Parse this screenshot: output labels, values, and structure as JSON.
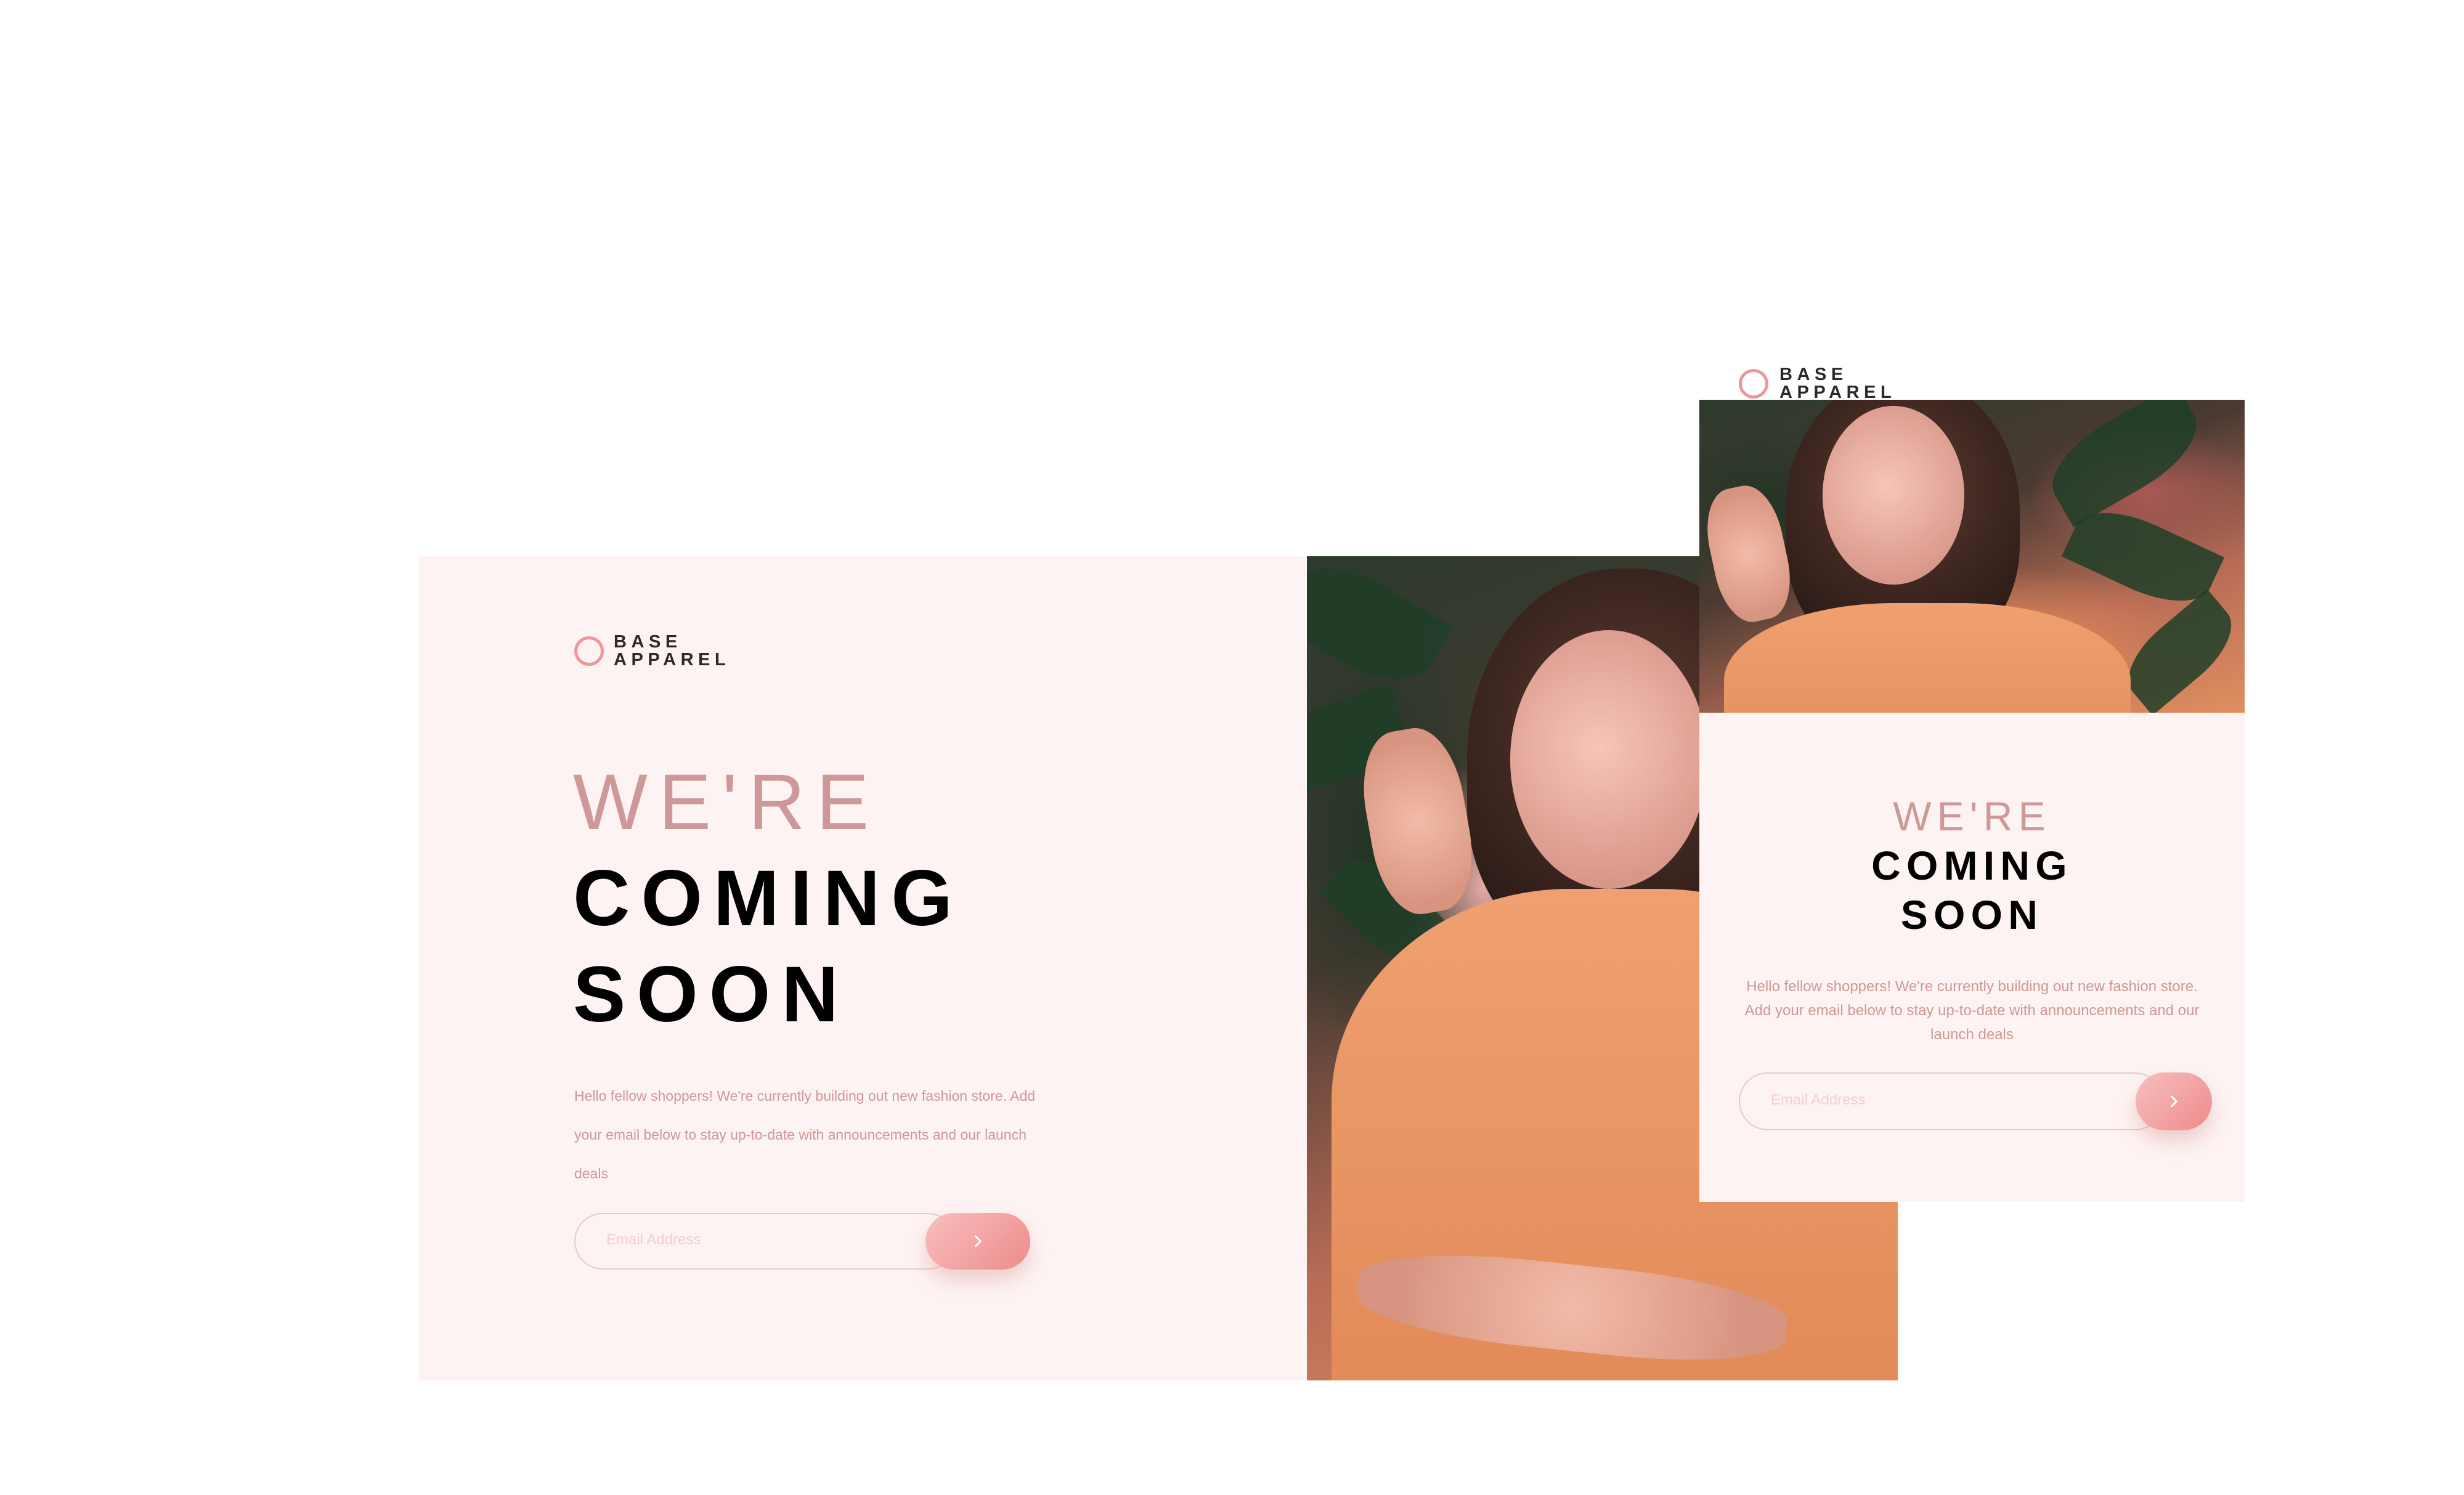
{
  "brand": {
    "logo_text": "BASE\nAPPAREL",
    "accent_color": "#f0959a",
    "heading_light_color": "#ce9898",
    "background_color": "#fdf3f2"
  },
  "desktop": {
    "headline_light": "WE'RE",
    "headline_bold_1": "COMING",
    "headline_bold_2": "SOON",
    "description": "Hello fellow shoppers! We're currently building out new fashion store. Add your email below to stay up-to-date with announcements and our launch deals",
    "email_placeholder": "Email Address",
    "submit_icon": "chevron-right-icon"
  },
  "mobile": {
    "headline_light": "WE'RE",
    "headline_bold_1": "COMING",
    "headline_bold_2": "SOON",
    "description": "Hello fellow shoppers! We're currently building out new fashion store. Add your email below to stay up-to-date with announcements and our launch deals",
    "email_placeholder": "Email Address",
    "submit_icon": "chevron-right-icon"
  }
}
